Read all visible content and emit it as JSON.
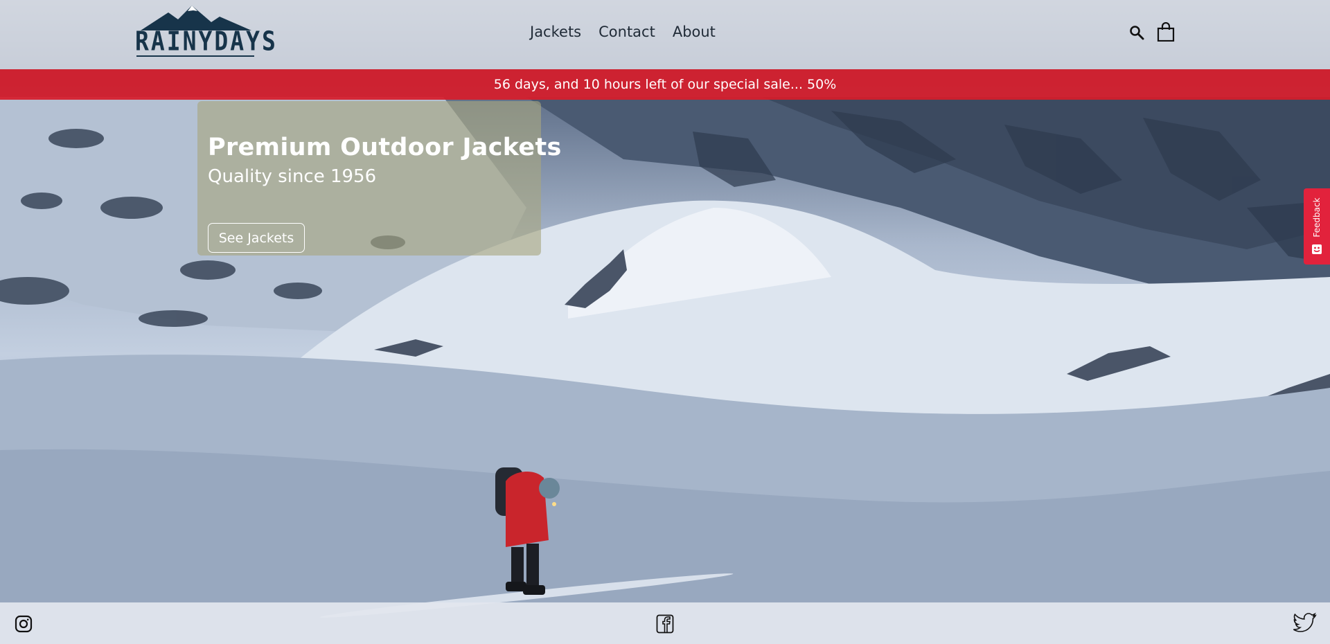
{
  "header": {
    "logo_text": "RAINYDAYS",
    "nav": [
      {
        "label": "Jackets"
      },
      {
        "label": "Contact"
      },
      {
        "label": "About"
      }
    ],
    "icons": {
      "search": "search-icon",
      "cart": "shopping-bag-icon"
    }
  },
  "sale_banner": {
    "text": "56 days, and 10 hours left of our special sale... 50%"
  },
  "hero": {
    "title": "Premium Outdoor Jackets",
    "subtitle": "Quality since 1956",
    "button_label": "See Jackets"
  },
  "feedback": {
    "label": "Feedback",
    "icon": "feedback-icon"
  },
  "footer": {
    "icons": [
      "instagram-icon",
      "facebook-icon",
      "twitter-icon"
    ]
  },
  "colors": {
    "banner_red": "#d71c2a",
    "logo_navy": "#17344a",
    "feedback_red": "#e2223c"
  }
}
